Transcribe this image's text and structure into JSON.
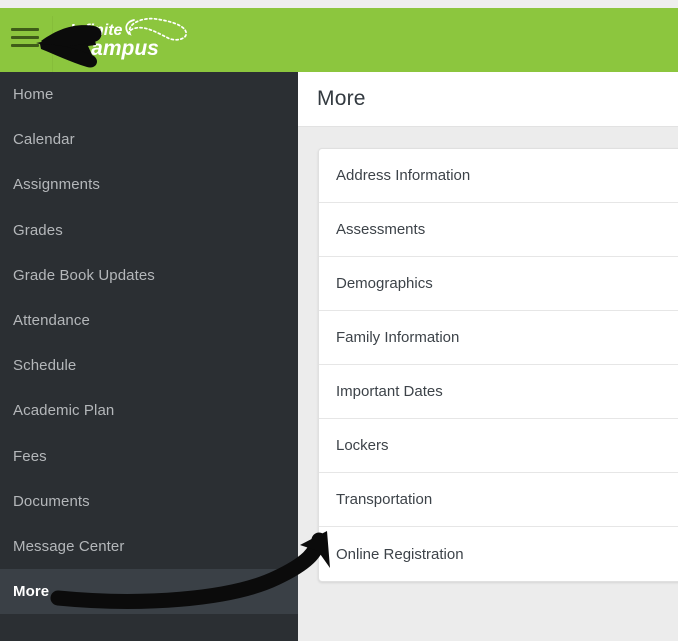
{
  "brand": {
    "logo_line1": "Infinite",
    "logo_line2": "Campus",
    "menu_icon": "hamburger-icon",
    "header_color": "#8cc63e"
  },
  "sidebar": {
    "background_color": "#2b2f33",
    "active_item": "More",
    "items": [
      {
        "label": "Home",
        "active": false
      },
      {
        "label": "Calendar",
        "active": false
      },
      {
        "label": "Assignments",
        "active": false
      },
      {
        "label": "Grades",
        "active": false
      },
      {
        "label": "Grade Book Updates",
        "active": false
      },
      {
        "label": "Attendance",
        "active": false
      },
      {
        "label": "Schedule",
        "active": false
      },
      {
        "label": "Academic Plan",
        "active": false
      },
      {
        "label": "Fees",
        "active": false
      },
      {
        "label": "Documents",
        "active": false
      },
      {
        "label": "Message Center",
        "active": false
      },
      {
        "label": "More",
        "active": true
      }
    ]
  },
  "main": {
    "page_title": "More",
    "list": [
      {
        "label": "Address Information"
      },
      {
        "label": "Assessments"
      },
      {
        "label": "Demographics"
      },
      {
        "label": "Family Information"
      },
      {
        "label": "Important Dates"
      },
      {
        "label": "Lockers"
      },
      {
        "label": "Transportation"
      },
      {
        "label": "Online Registration"
      }
    ]
  },
  "annotations": {
    "left_arrow": "arrow pointing left toward the hamburger menu icon",
    "curved_arrow": "curved arrow from the More sidebar item to the Online Registration list row",
    "color": "#000000"
  }
}
